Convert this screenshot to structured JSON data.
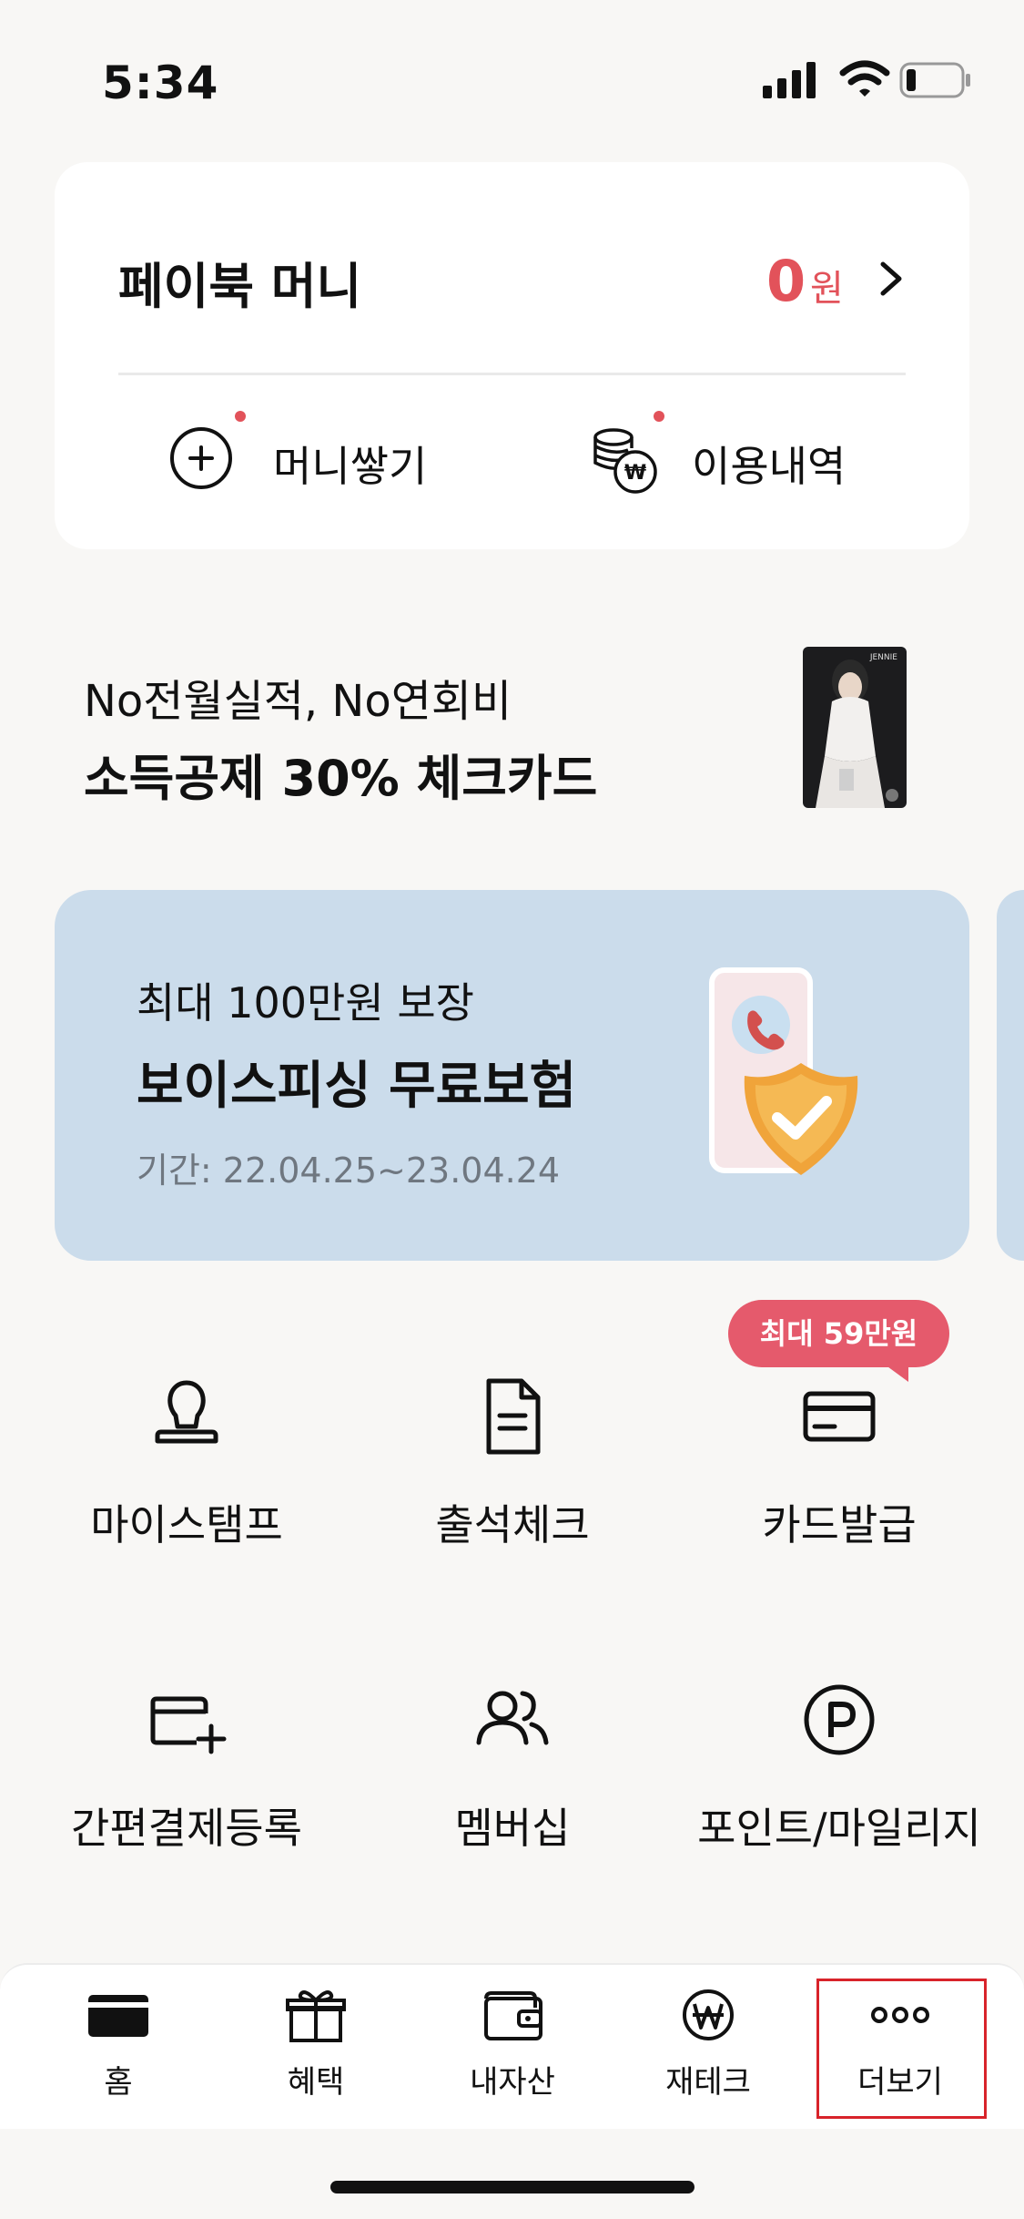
{
  "status": {
    "time": "5:34"
  },
  "money": {
    "title": "페이북 머니",
    "amount": "0",
    "unit": "원",
    "charge_label": "머니쌓기",
    "history_label": "이용내역"
  },
  "promo": {
    "subtitle": "No전월실적, No연회비",
    "title": "소득공제 30% 체크카드",
    "card_name": "JENNIE"
  },
  "banner": {
    "subtitle": "최대 100만원 보장",
    "title": "보이스피싱 무료보험",
    "period": "기간: 22.04.25~23.04.24"
  },
  "grid": {
    "tooltip": "최대 59만원",
    "items": [
      {
        "label": "마이스탬프",
        "icon": "stamp-icon"
      },
      {
        "label": "출석체크",
        "icon": "document-icon"
      },
      {
        "label": "카드발급",
        "icon": "card-icon"
      },
      {
        "label": "간편결제등록",
        "icon": "card-add-icon"
      },
      {
        "label": "멤버십",
        "icon": "users-icon"
      },
      {
        "label": "포인트/마일리지",
        "icon": "point-icon"
      }
    ]
  },
  "tabs": [
    {
      "label": "홈",
      "icon": "card-tab-icon"
    },
    {
      "label": "혜택",
      "icon": "gift-icon"
    },
    {
      "label": "내자산",
      "icon": "wallet-icon"
    },
    {
      "label": "재테크",
      "icon": "won-icon"
    },
    {
      "label": "더보기",
      "icon": "more-icon"
    }
  ],
  "colors": {
    "accent": "#e2525a",
    "banner": "#cbdceb",
    "tooltip": "#e55a6c",
    "highlight": "#d8232a"
  }
}
